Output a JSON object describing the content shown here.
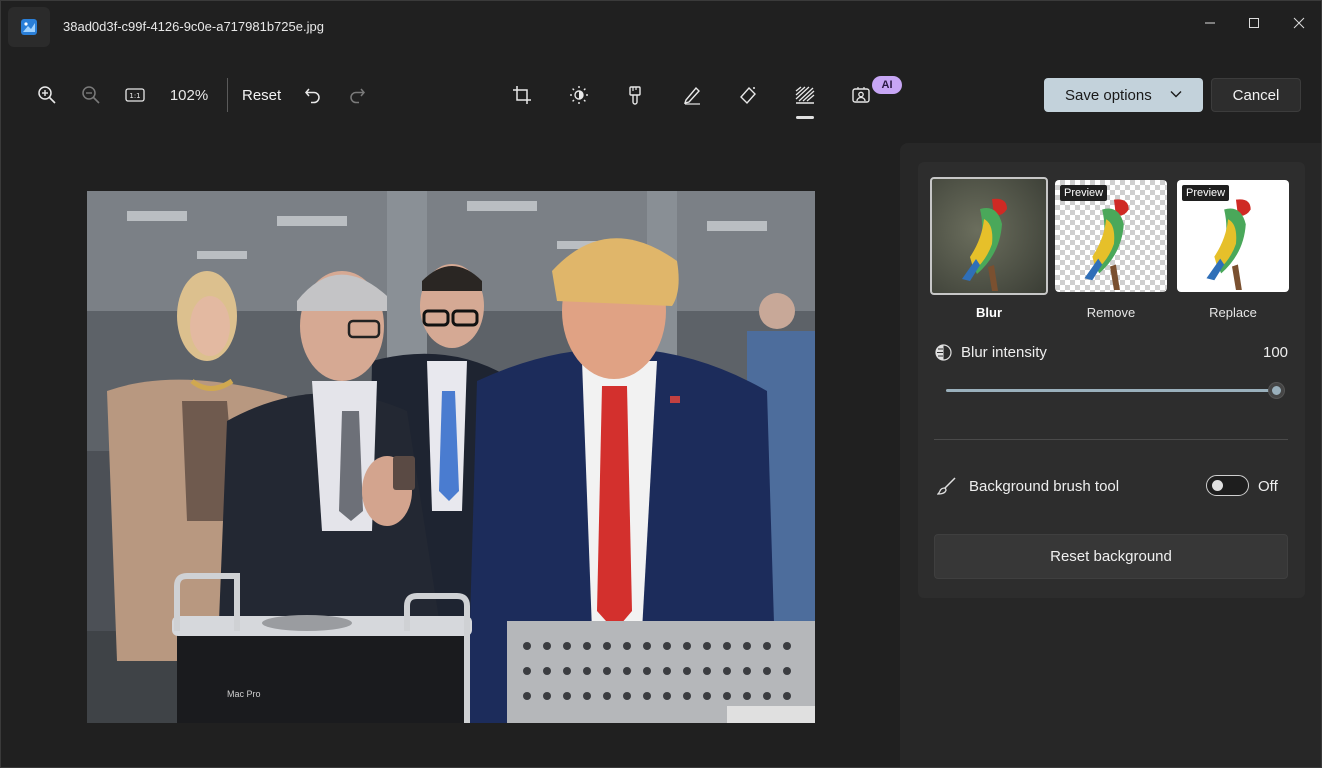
{
  "window": {
    "title": "38ad0d3f-c99f-4126-9c0e-a717981b725e.jpg"
  },
  "toolbar": {
    "zoom_level": "102%",
    "reset_label": "Reset",
    "ai_badge": "AI",
    "save_label": "Save options",
    "cancel_label": "Cancel"
  },
  "image": {
    "mac_text": "Mac Pro"
  },
  "background_panel": {
    "options": [
      {
        "label": "Blur",
        "tag": ""
      },
      {
        "label": "Remove",
        "tag": "Preview"
      },
      {
        "label": "Replace",
        "tag": "Preview"
      }
    ],
    "blur_intensity_label": "Blur intensity",
    "blur_intensity_value": "100",
    "brush_tool_label": "Background brush tool",
    "brush_tool_state": "Off",
    "reset_background_label": "Reset background"
  },
  "colors": {
    "accent": "#9ab0bc",
    "save_button": "#c3d2db",
    "ai_badge": "#c7a6f5"
  }
}
